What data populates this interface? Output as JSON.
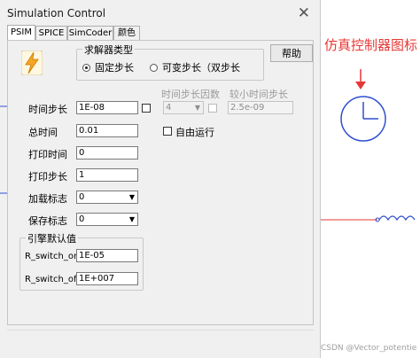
{
  "window": {
    "title": "Simulation Control",
    "close_glyph": "✕"
  },
  "tabs": [
    {
      "label": "PSIM",
      "active": true
    },
    {
      "label": "SPICE",
      "active": false
    },
    {
      "label": "SimCoder",
      "active": false
    },
    {
      "label": "颜色",
      "active": false
    }
  ],
  "solver": {
    "group_label": "求解器类型",
    "options": [
      {
        "label": "固定步长",
        "selected": true
      },
      {
        "label": "可变步长（双步长",
        "selected": false
      }
    ]
  },
  "help_button": "帮助",
  "fields": {
    "time_step": {
      "label": "时间步长",
      "value": "1E-08"
    },
    "total_time": {
      "label": "总时间",
      "value": "0.01"
    },
    "print_time": {
      "label": "打印时间",
      "value": "0"
    },
    "print_step": {
      "label": "打印步长",
      "value": "1"
    },
    "load_flag": {
      "label": "加载标志",
      "value": "0"
    },
    "save_flag": {
      "label": "保存标志",
      "value": "0"
    }
  },
  "disabled": {
    "time_step_factor": {
      "label": "时间步长因数",
      "value": "4"
    },
    "min_time_step": {
      "label": "较小时间步长",
      "value": "2.5e-09"
    }
  },
  "free_run_label": "自由运行",
  "engine_defaults": {
    "group_label": "引擎默认值",
    "r_switch_on": {
      "label": "R_switch_on",
      "value": "1E-05"
    },
    "r_switch_off": {
      "label": "R_switch_off",
      "value": "1E+007"
    }
  },
  "annotation": "仿真控制器图标",
  "watermark": "CSDN @Vector_potentie",
  "colors": {
    "annotation_red": "#e53935",
    "wire_blue": "#2f4fd0"
  },
  "icons": {
    "psim_logo": "lightning-bolt-icon",
    "clock": "clock-icon",
    "inductor": "inductor-icon"
  }
}
